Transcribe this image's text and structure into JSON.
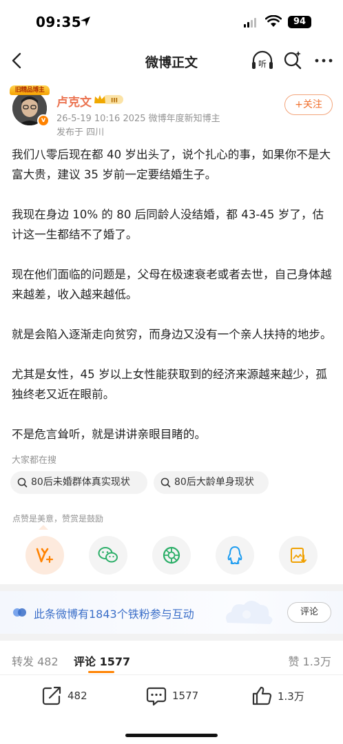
{
  "status_bar": {
    "time": "09:35",
    "battery": "94",
    "icons": [
      "location-arrow-icon",
      "signal-icon",
      "wifi-icon",
      "battery-icon"
    ]
  },
  "nav": {
    "title": "微博正文",
    "listen_label": "听",
    "icons": [
      "back-arrow-icon",
      "listen-headphones-icon",
      "ai-search-icon",
      "more-dots-icon"
    ]
  },
  "author": {
    "avatar_banner": "旧精品博主",
    "name": "卢克文",
    "meta": "26-5-19 10:16  2025 微博年度新知博主",
    "location": "发布于 四川",
    "follow_label": "+关注",
    "badge_level": "III"
  },
  "post": {
    "paragraphs": [
      "我们八零后现在都 40 岁出头了，说个扎心的事，如果你不是大富大贵，建议 35 岁前一定要结婚生子。",
      "我现在身边 10% 的 80 后同龄人没结婚，都 43-45 岁了，估计这一生都结不了婚了。",
      "现在他们面临的问题是，父母在极速衰老或者去世，自己身体越来越差，收入越来越低。",
      "就是会陷入逐渐走向贫穷，而身边又没有一个亲人扶持的地步。",
      "尤其是女性，45 岁以上女性能获取到的经济来源越来越少，孤独终老又近在眼前。",
      "不是危言耸听，就是讲讲亲眼目睹的。"
    ]
  },
  "search": {
    "heading": "大家都在搜",
    "chips": [
      "80后未婚群体真实现状",
      "80后大龄单身现状"
    ]
  },
  "reward": {
    "hint": "点赞是美意，赞赏是鼓励"
  },
  "share": {
    "items": [
      "reward-v-icon",
      "wechat-icon",
      "moments-icon",
      "qq-icon",
      "save-image-icon"
    ]
  },
  "fans": {
    "text": "此条微博有1843个铁粉参与互动",
    "button": "评论"
  },
  "tabs": {
    "repost": "转发 482",
    "comment": "评论 1577",
    "like": "赞 1.3万"
  },
  "actions": {
    "repost_count": "482",
    "comment_count": "1577",
    "like_count": "1.3万"
  },
  "colors": {
    "accent": "#ff8200",
    "name": "#eb7350",
    "link_blue": "#3a6ec8"
  }
}
